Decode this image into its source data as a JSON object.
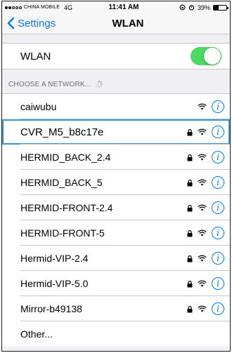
{
  "status_bar": {
    "carrier": "CHINA MOBILE",
    "network_type": "4G",
    "time": "11:41 AM",
    "battery_percent": "39%",
    "battery_level": 0.39
  },
  "nav": {
    "back_label": "Settings",
    "title": "WLAN"
  },
  "wlan": {
    "label": "WLAN",
    "enabled": true,
    "toggle_color": "#4cd964"
  },
  "section": {
    "header": "CHOOSE A NETWORK..."
  },
  "networks": [
    {
      "name": "caiwubu",
      "locked": false,
      "selected": false
    },
    {
      "name": "CVR_M5_b8c17e",
      "locked": true,
      "selected": true
    },
    {
      "name": "HERMID_BACK_2.4",
      "locked": true,
      "selected": false
    },
    {
      "name": "HERMID_BACK_5",
      "locked": true,
      "selected": false
    },
    {
      "name": "HERMID-FRONT-2.4",
      "locked": true,
      "selected": false
    },
    {
      "name": "HERMID-FRONT-5",
      "locked": true,
      "selected": false
    },
    {
      "name": "Hermid-VIP-2.4",
      "locked": true,
      "selected": false
    },
    {
      "name": "Hermid-VIP-5.0",
      "locked": true,
      "selected": false
    },
    {
      "name": "Mirror-b49138",
      "locked": true,
      "selected": false
    }
  ],
  "other_label": "Other...",
  "info_glyph": "i",
  "accent_color": "#007aff",
  "icons": {
    "lock": "lock-icon",
    "wifi": "wifi-icon",
    "info": "info-icon",
    "back": "chevron-left-icon"
  }
}
